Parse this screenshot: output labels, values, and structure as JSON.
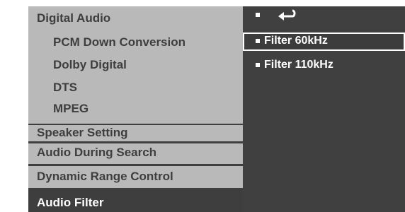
{
  "menu": {
    "digital_audio": {
      "label": "Digital Audio",
      "sub_items": [
        "PCM Down Conversion",
        "Dolby Digital",
        "DTS",
        "MPEG"
      ]
    },
    "speaker_setting": "Speaker Setting",
    "audio_during_search": "Audio  During Search",
    "dynamic_range_control": "Dynamic Range Control",
    "audio_filter": "Audio Filter"
  },
  "options": {
    "return_icon": "return-arrow-icon",
    "items": [
      "Filter 60kHz",
      "Filter 110kHz"
    ],
    "highlighted": "Filter 60kHz"
  },
  "colors": {
    "panel_dark": "#3e3e3e",
    "panel_light": "#b9b9b9",
    "text_light": "#ffffff"
  }
}
